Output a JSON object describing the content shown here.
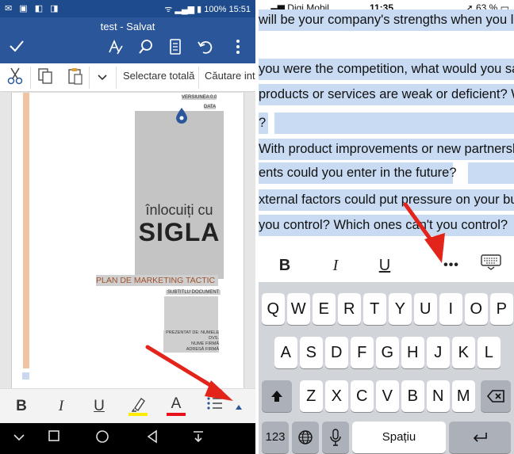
{
  "android": {
    "status_bar": {
      "left_icons": "✉ ▣ ◧ ◨",
      "right_text": "ᯤ ▂▄▆ ▮ 100% 15:51"
    },
    "doc_title": "test - Salvat",
    "toolbar_icons": [
      "check-icon",
      "format-painter-icon",
      "search-icon",
      "mobile-view-icon",
      "undo-icon",
      "more-vertical-icon"
    ],
    "ribbon": {
      "select_all": "Selectare totală",
      "search": "Căutare int"
    },
    "document": {
      "version": "VERSIUNEA 0.0",
      "date": "DATA",
      "logo_line1": "înlocuiți cu",
      "logo_line2": "SIGLA",
      "plan": "PLAN DE MARKETING TACTIC",
      "subtitle": "SUBTITLU DOCUMENT",
      "presented_by": "PREZENTAT DE: NUMELE DVS.",
      "company_name": "NUME FIRMĂ",
      "company_address": "ADRESĂ FIRMĂ"
    },
    "format_bar": {
      "bold": "B",
      "italic": "I",
      "underline": "U",
      "font_color": "A",
      "highlight_color": "#ffeb00",
      "font_color_bar": "#e8111a"
    }
  },
  "ios": {
    "status_bar": {
      "carrier": "▂▄▆ Digi.Mobil",
      "time": "11:35",
      "right": "➚ 63 % ▭"
    },
    "doc_lines": [
      "will be your company's strengths when you la",
      "you were the competition, what would you say",
      "products or services are weak or deficient? Wh",
      "?",
      "With product improvements or new partnersh",
      "ents could you enter in the future?",
      "xternal factors could put pressure on your bu",
      " you control? Which ones can't you control? "
    ],
    "toolbar": {
      "bold": "B",
      "italic": "I",
      "underline": "U",
      "more": "•••"
    },
    "keyboard": {
      "row1": [
        "Q",
        "W",
        "E",
        "R",
        "T",
        "Y",
        "U",
        "I",
        "O",
        "P"
      ],
      "row2": [
        "A",
        "S",
        "D",
        "F",
        "G",
        "H",
        "J",
        "K",
        "L"
      ],
      "row3": [
        "Z",
        "X",
        "C",
        "V",
        "B",
        "N",
        "M"
      ],
      "numbers": "123",
      "space": "Spațiu"
    }
  },
  "colors": {
    "word_blue": "#2b579a",
    "selection": "#c8dbf2",
    "arrow_red": "#e3241b"
  }
}
